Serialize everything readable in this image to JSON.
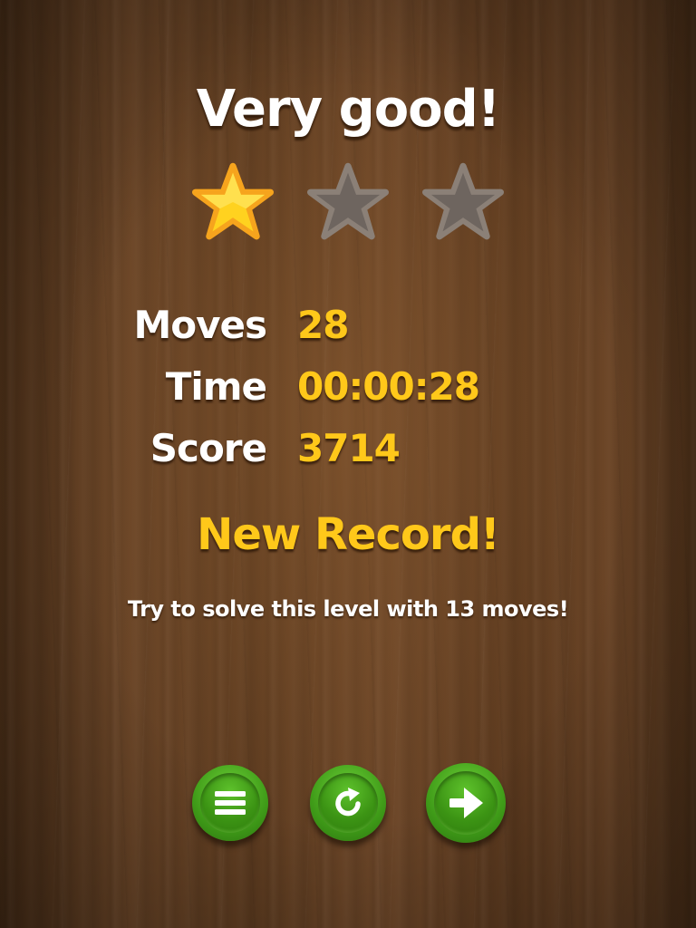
{
  "result": {
    "title": "Very good!",
    "stars_earned": 1,
    "stars_total": 3,
    "new_record": "New Record!",
    "hint": "Try to solve this level with 13 moves!"
  },
  "stats": [
    {
      "label": "Moves",
      "value": "28"
    },
    {
      "label": "Time",
      "value": "00:00:28"
    },
    {
      "label": "Score",
      "value": "3714"
    }
  ],
  "buttons": {
    "menu": {
      "icon": "menu-icon"
    },
    "restart": {
      "icon": "restart-icon"
    },
    "next": {
      "icon": "arrow-right-icon"
    }
  },
  "colors": {
    "accent_yellow": "#ffc81a",
    "star_gold": "#ffd21f",
    "star_empty": "#6e655f",
    "button_green": "#3f9b18",
    "wood": "#5e3c20"
  }
}
